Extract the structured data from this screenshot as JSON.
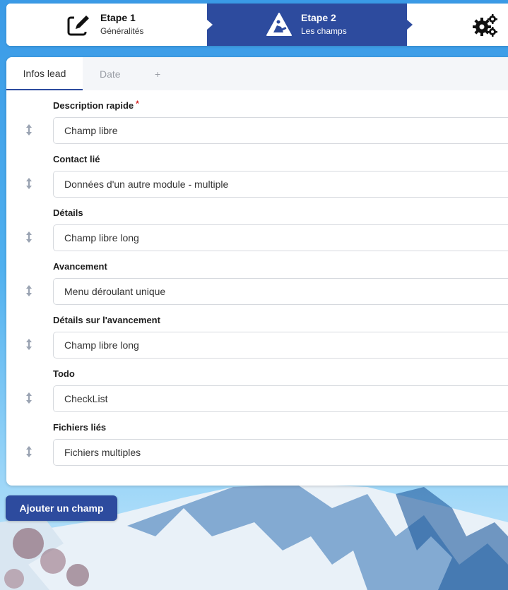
{
  "stepper": {
    "steps": [
      {
        "title": "Etape 1",
        "subtitle": "Généralités",
        "icon": "edit-icon"
      },
      {
        "title": "Etape 2",
        "subtitle": "Les champs",
        "icon": "construction-icon",
        "active": true
      },
      {
        "title": "",
        "subtitle": "",
        "icon": "gears-icon"
      }
    ]
  },
  "tabs": [
    {
      "label": "Infos lead",
      "active": true
    },
    {
      "label": "Date",
      "active": false
    },
    {
      "label": "+",
      "active": false
    }
  ],
  "fields": [
    {
      "label": "Description rapide",
      "required": "*",
      "type": "Champ libre"
    },
    {
      "label": "Contact lié",
      "type": "Données d'un autre module - multiple"
    },
    {
      "label": "Détails",
      "type": "Champ libre long"
    },
    {
      "label": "Avancement",
      "type": "Menu déroulant unique"
    },
    {
      "label": "Détails sur l'avancement",
      "type": "Champ libre long"
    },
    {
      "label": "Todo",
      "type": "CheckList"
    },
    {
      "label": "Fichiers liés",
      "type": "Fichiers multiples"
    }
  ],
  "actions": {
    "add_field": "Ajouter un champ"
  },
  "colors": {
    "primary": "#2d4b9e",
    "required": "#d62828",
    "sky": "#4fb0ef"
  }
}
